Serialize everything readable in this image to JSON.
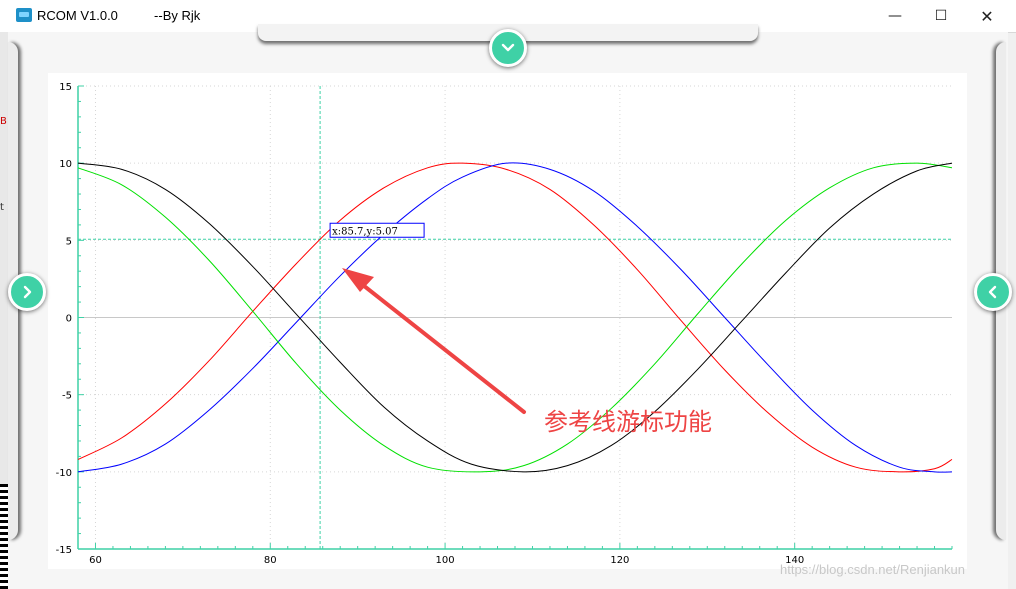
{
  "window": {
    "title": "RCOM V1.0.0          --By Rjk",
    "minimize_glyph": "—",
    "maximize_glyph": "☐",
    "close_glyph": "✕"
  },
  "side_marks": {
    "top": "B",
    "middle": "t"
  },
  "drawer_icons": {
    "top": "chevron-down-icon",
    "left": "chevron-right-icon",
    "right": "chevron-left-icon",
    "button_color": "#3fd1a6"
  },
  "chart_data": {
    "type": "line",
    "title": "",
    "xlabel": "",
    "ylabel": "",
    "xlim": [
      58,
      158
    ],
    "ylim": [
      -15,
      15
    ],
    "x_ticks": [
      60,
      80,
      100,
      120,
      140
    ],
    "y_ticks": [
      15,
      10,
      5,
      0,
      -5,
      -10,
      -15
    ],
    "grid": true,
    "series": [
      {
        "color": "#ff0000",
        "x": [
          58,
          63,
          68,
          73,
          78,
          83,
          88,
          93,
          98,
          102,
          107,
          112,
          117,
          122,
          127,
          132,
          137,
          142,
          147,
          152,
          156,
          158
        ],
        "y": [
          -9.2,
          -7.8,
          -5.6,
          -2.8,
          0.4,
          3.5,
          6.3,
          8.4,
          9.7,
          10,
          9.6,
          8.3,
          6,
          3.1,
          -0.2,
          -3.4,
          -6.2,
          -8.4,
          -9.7,
          -10,
          -9.8,
          -9.2
        ]
      },
      {
        "color": "#0000ff",
        "x": [
          58,
          63,
          68,
          73,
          78,
          83,
          88,
          93,
          98,
          102,
          107,
          112,
          117,
          122,
          127,
          132,
          137,
          142,
          147,
          152,
          156,
          158
        ],
        "y": [
          -10,
          -9.5,
          -8.2,
          -6,
          -3.3,
          -0.3,
          2.7,
          5.4,
          7.7,
          9.1,
          10,
          9.6,
          8.2,
          5.9,
          3.1,
          0,
          -3.1,
          -6,
          -8.3,
          -9.7,
          -10,
          -10
        ]
      },
      {
        "color": "#00e000",
        "x": [
          58,
          63,
          68,
          73,
          78,
          83,
          88,
          93,
          98,
          104,
          109,
          114,
          119,
          124,
          129,
          134,
          139,
          144,
          149,
          154,
          158
        ],
        "y": [
          9.7,
          8.6,
          6.5,
          3.7,
          0.4,
          -3,
          -6,
          -8.3,
          -9.7,
          -10,
          -9.6,
          -8.2,
          -5.9,
          -3,
          0.3,
          3.5,
          6.3,
          8.4,
          9.7,
          10,
          9.7
        ]
      },
      {
        "color": "#000000",
        "x": [
          58,
          63,
          68,
          73,
          78,
          83,
          88,
          93,
          98,
          103,
          109,
          114,
          119,
          124,
          129,
          134,
          139,
          144,
          149,
          154,
          158
        ],
        "y": [
          10,
          9.6,
          8.3,
          6.1,
          3.3,
          0.2,
          -2.9,
          -5.8,
          -8,
          -9.5,
          -10,
          -9.6,
          -8.3,
          -6.1,
          -3.3,
          -0.2,
          2.9,
          5.8,
          8,
          9.5,
          10
        ]
      }
    ],
    "cursor": {
      "x": 85.7,
      "y": 5.07,
      "label": "x:85.7,y:5.07",
      "color": "#3fd1a6"
    },
    "annotation": {
      "text": "参考线游标功能",
      "color": "#ee4444"
    }
  },
  "watermark": "https://blog.csdn.net/Renjiankun"
}
